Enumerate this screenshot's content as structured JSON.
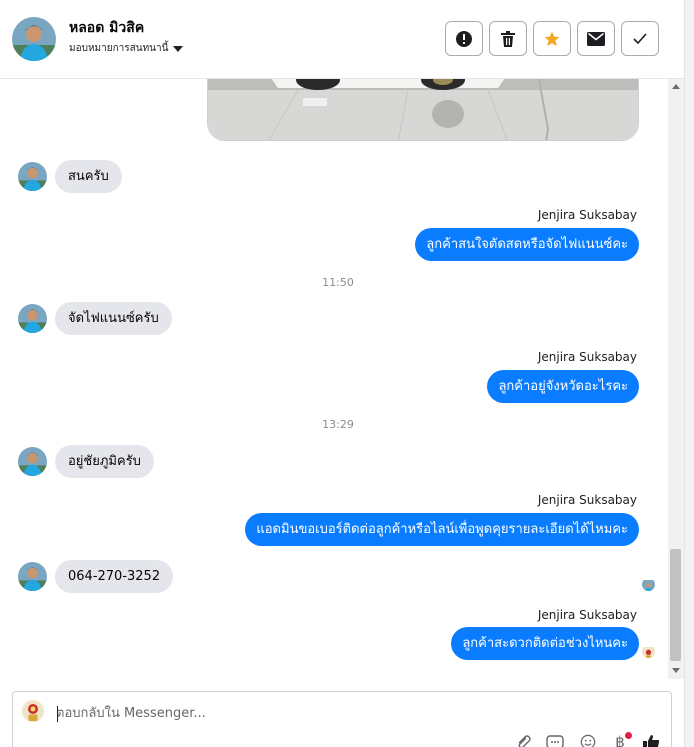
{
  "header": {
    "contact_name": "หลอด มิวสิค",
    "assign_label": "มอบหมายการสนทนานี้",
    "actions": [
      {
        "name": "report",
        "icon": "exclamation-icon"
      },
      {
        "name": "delete",
        "icon": "trash-icon"
      },
      {
        "name": "star",
        "icon": "star-icon",
        "color": "#f5a623"
      },
      {
        "name": "mark-unread",
        "icon": "envelope-icon"
      },
      {
        "name": "done",
        "icon": "checkmark-icon"
      }
    ]
  },
  "messages": [
    {
      "type": "incoming",
      "text": "สนครับ"
    },
    {
      "type": "outgoing",
      "sender": "Jenjira Suksabay",
      "text": "ลูกค้าสนใจตัดสดหรือจัดไฟแนนซ์คะ"
    },
    {
      "type": "timestamp",
      "text": "11:50"
    },
    {
      "type": "incoming",
      "text": "จัดไฟแนนซ์ครับ"
    },
    {
      "type": "outgoing",
      "sender": "Jenjira Suksabay",
      "text": "ลูกค้าอยู่จังหวัดอะไรคะ"
    },
    {
      "type": "timestamp",
      "text": "13:29"
    },
    {
      "type": "incoming",
      "text": "อยู่ชัยภูมิครับ"
    },
    {
      "type": "outgoing",
      "sender": "Jenjira Suksabay",
      "text": "แอดมินขอเบอร์ติดต่อลูกค้าหรือไลน์เพื่อพูดคุยรายละเอียดได้ไหมคะ"
    },
    {
      "type": "incoming",
      "text": "064-270-3252"
    },
    {
      "type": "outgoing",
      "sender": "Jenjira Suksabay",
      "text": "ลูกค้าสะดวกติดต่อช่วงไหนคะ"
    }
  ],
  "composer": {
    "placeholder": "ตอบกลับใน Messenger...",
    "tools": [
      "paperclip-icon",
      "gif-icon",
      "emoji-icon",
      "baht-icon",
      "thumbs-up-icon"
    ]
  },
  "colors": {
    "outgoing_bubble": "#0a7cff",
    "incoming_bubble": "#e4e6eb",
    "star": "#f5a623",
    "notification_dot": "#e41e3f"
  }
}
